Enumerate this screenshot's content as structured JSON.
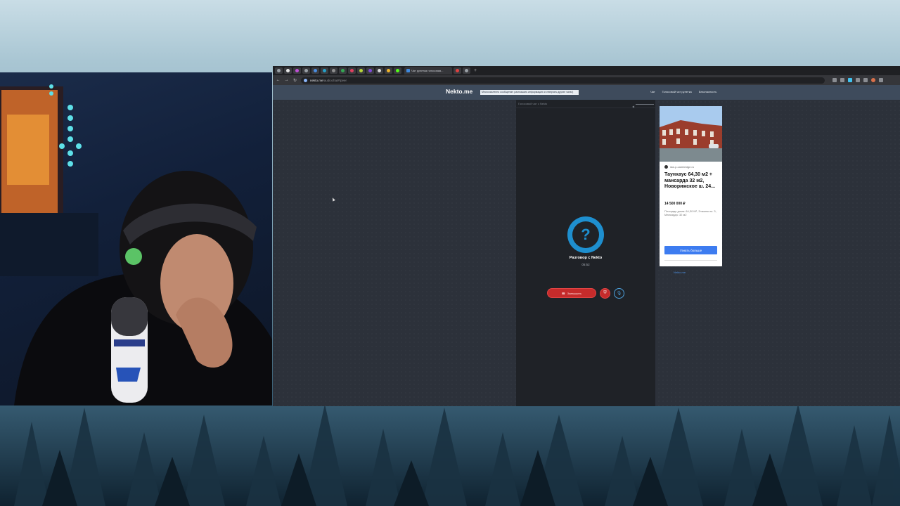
{
  "browser": {
    "active_tab_title": "Чат рулетка голосовая...",
    "url_host": "nekto.me",
    "url_path": "/audiochat#/peer"
  },
  "site": {
    "logo": "Nekto.me",
    "notice": "Многочисленно сообщение: разглашать информацию и отвергать другие чатах)",
    "nav": [
      "Чат",
      "Голосовой чат рулетка",
      "Безопасность"
    ]
  },
  "chat": {
    "header": "Голосовой чат с Nekto",
    "avatar_glyph": "?",
    "title": "Разговор с Nekto",
    "timer": "05:52",
    "end_button": "Завершить",
    "end_icon": "phone-hangup-icon",
    "report_icon": "shield-icon",
    "mic_icon": "microphone-icon"
  },
  "ad": {
    "domain": "sks.p-cambridge.ru",
    "title": "Таунхаус 64,30 м2 + мансарда 32 м2, Новорижское ш. 24...",
    "price": "14 500 000 ₽",
    "description": "Площадь дома: 64,30 М², Этажность: 3, Мансарда: 32 м2",
    "button": "Узнать больше",
    "footer_link": "Nekto.me"
  },
  "colors": {
    "accent": "#1e8fcf",
    "danger": "#c62b2b",
    "ad_button": "#3d7cf0"
  }
}
